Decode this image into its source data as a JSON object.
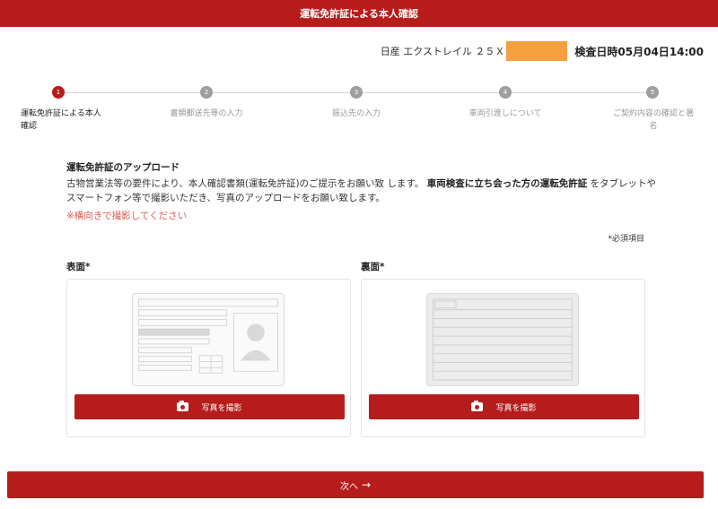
{
  "header": {
    "title": "運転免許証による本人確認"
  },
  "vehicle": {
    "name": "日産 エクストレイル ２５Ｘ",
    "inspection_datetime": "検査日時05月04日14:00"
  },
  "steps": [
    {
      "number": "1",
      "label": "運転免許証による本人確認",
      "active": true
    },
    {
      "number": "2",
      "label": "書類郵送先等の入力"
    },
    {
      "number": "3",
      "label": "振込先の入力"
    },
    {
      "number": "4",
      "label": "車両引渡しについて"
    },
    {
      "number": "5",
      "label": "ご契約内容の確認と署名"
    }
  ],
  "upload": {
    "title": "運転免許証のアップロード",
    "description_part1": "古物営業法等の要件により、本人確認書類(運転免許証)のご提示をお願い致 します。",
    "description_bold": "車両検査に立ち会った方の運転免許証",
    "description_part2": "をタブレットやスマートフォン等で撮影いただき、写真のアップロードをお願い致します。",
    "warning": "※横向きで撮影してください",
    "required_note": "*必須項目"
  },
  "front": {
    "label": "表面*",
    "button_label": "写真を撮影"
  },
  "back": {
    "label": "裏面*",
    "button_label": "写真を撮影"
  },
  "next_button": {
    "label": "次へ",
    "arrow": "→"
  },
  "colors": {
    "primary": "#b71c1c",
    "warning": "#e0574f",
    "redaction": "#f3a040",
    "inactive_step": "#9e9e9e"
  }
}
